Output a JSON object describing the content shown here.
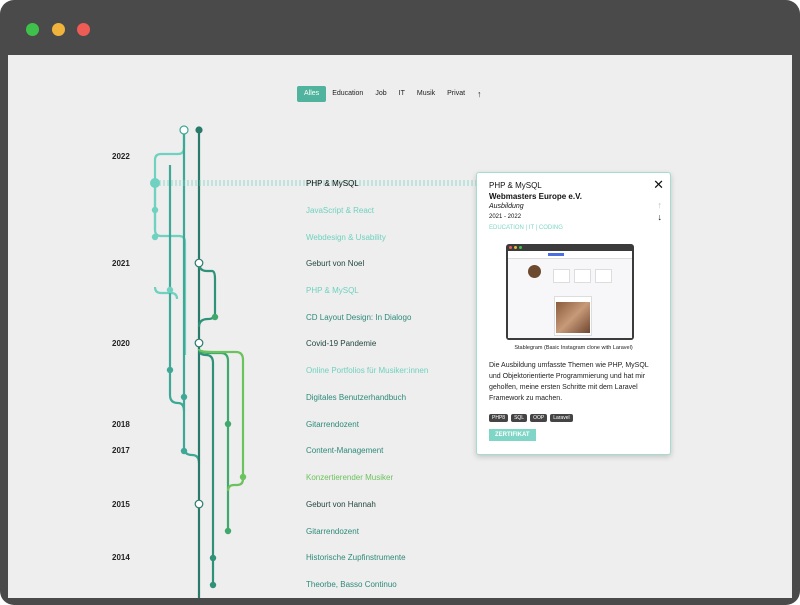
{
  "filters": {
    "items": [
      "Alles",
      "Education",
      "Job",
      "IT",
      "Musik",
      "Privat"
    ],
    "active": "Alles",
    "scroll_top_icon": "arrow-up-icon"
  },
  "years": [
    "2022",
    "2021",
    "2020",
    "2018",
    "2017",
    "2015",
    "2014"
  ],
  "entries": [
    "PHP & MySQL",
    "JavaScript & React",
    "Webdesign & Usability",
    "Geburt von Noel",
    "PHP & MySQL",
    "CD Layout Design: In Dialogo",
    "Covid-19 Pandemie",
    "Online Portfolios für Musiker:innen",
    "Digitales Benutzerhandbuch",
    "Gitarrendozent",
    "Content-Management",
    "Konzertierender Musiker",
    "Geburt von Hannah",
    "Gitarrendozent",
    "Historische Zupfinstrumente",
    "Theorbe, Basso Continuo"
  ],
  "colors": {
    "light": "#6fd1bf",
    "teal": "#2d8a7a",
    "dark": "#24473f",
    "lime": "#6cc25e",
    "accent": "#4fb39d"
  },
  "detail": {
    "title": "PHP & MySQL",
    "org": "Webmasters Europe e.V.",
    "type": "Ausbildung",
    "years": "2021 - 2022",
    "categories": "EDUCATION | IT | CODING",
    "image_caption": "Stablegram (Basic Instagram clone with Laravel)",
    "description": "Die Ausbildung umfasste Themen wie PHP, MySQL und Objektorientierte Programmierung und hat mir geholfen, meine ersten Schritte mit dem Laravel Framework zu machen.",
    "tags": [
      "PHP8",
      "SQL",
      "OOP",
      "Laravel"
    ],
    "certificate_label": "ZERTIFIKAT",
    "close_icon": "close-icon",
    "prev_icon": "arrow-up-icon",
    "next_icon": "arrow-down-icon"
  }
}
